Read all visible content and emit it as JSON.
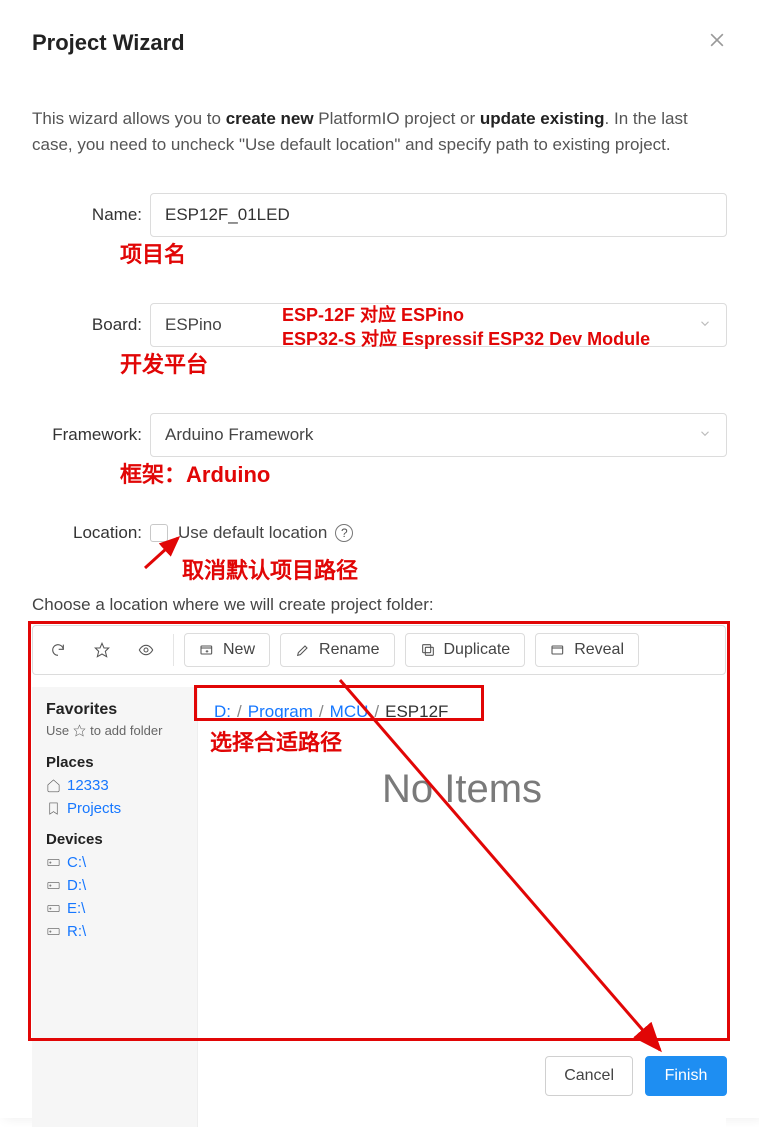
{
  "header": {
    "title": "Project Wizard"
  },
  "intro": {
    "pre": "This wizard allows you to ",
    "b1": "create new",
    "mid": " PlatformIO project or ",
    "b2": "update existing",
    "post": ". In the last case, you need to uncheck \"Use default location\" and specify path to existing project."
  },
  "form": {
    "name_label": "Name:",
    "name_value": "ESP12F_01LED",
    "board_label": "Board:",
    "board_value": "ESPino",
    "framework_label": "Framework:",
    "framework_value": "Arduino Framework",
    "location_label": "Location:",
    "use_default": "Use default location"
  },
  "annotations": {
    "proj": "项目名",
    "board": "开发平台",
    "framework": "框架：Arduino",
    "board_line1": "ESP-12F   对应   ESPino",
    "board_line2": "ESP32-S   对应   Espressif ESP32 Dev Module",
    "cancel_default": "取消默认项目路径",
    "choose_path": "选择合适路径"
  },
  "choose_text": "Choose a location where we will create project folder:",
  "toolbar": {
    "new": "New",
    "rename": "Rename",
    "duplicate": "Duplicate",
    "reveal": "Reveal"
  },
  "sidebar": {
    "favorites": "Favorites",
    "hint_pre": "Use ",
    "hint_post": " to add folder",
    "places": "Places",
    "place_home": "12333",
    "place_projects": "Projects",
    "devices": "Devices",
    "drives": [
      "C:\\",
      "D:\\",
      "E:\\",
      "R:\\"
    ]
  },
  "breadcrumb": {
    "d": "D:",
    "p1": "Program",
    "p2": "MCU",
    "cur": "ESP12F"
  },
  "noitems": "No Items",
  "footer": {
    "cancel": "Cancel",
    "finish": "Finish"
  }
}
